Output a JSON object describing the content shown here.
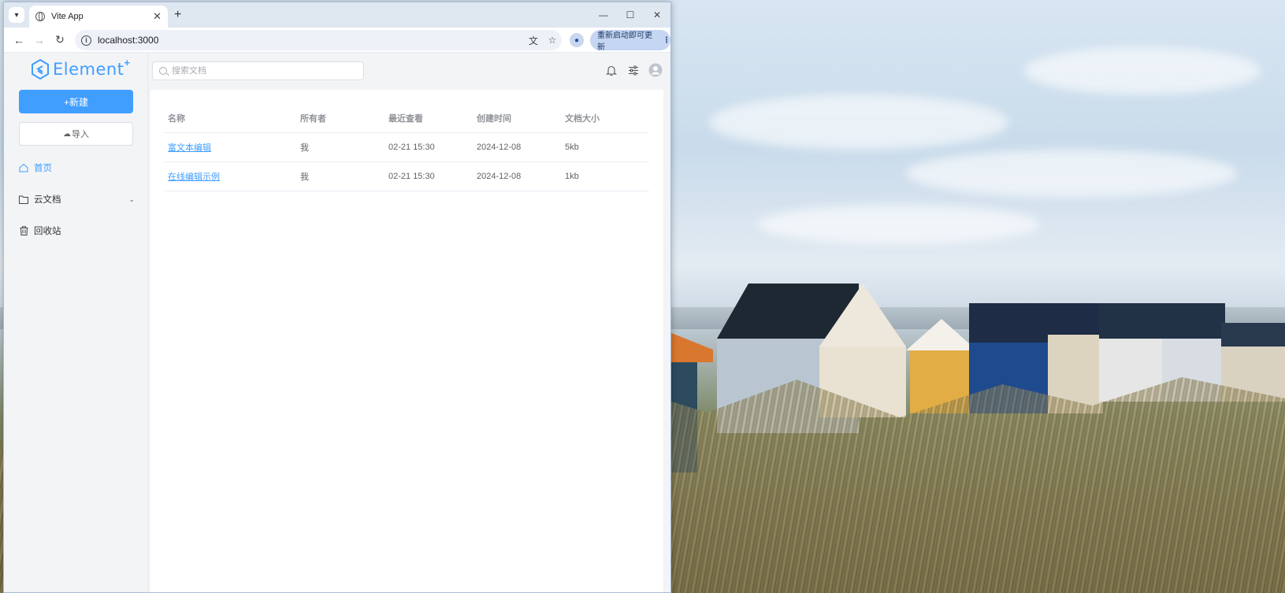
{
  "browser": {
    "tab_title": "Vite App",
    "url": "localhost:3000",
    "update_label": "重新启动即可更新"
  },
  "app": {
    "logo_text": "Element",
    "logo_plus": "+",
    "new_button": "+新建",
    "import_button": "导入",
    "search_placeholder": "搜索文档",
    "menu": [
      {
        "label": "首页",
        "icon": "home-icon",
        "active": true
      },
      {
        "label": "云文档",
        "icon": "folder-icon",
        "expandable": true
      },
      {
        "label": "回收站",
        "icon": "trash-icon"
      }
    ],
    "table": {
      "headers": [
        "名称",
        "所有者",
        "最近查看",
        "创建时间",
        "文档大小"
      ],
      "rows": [
        {
          "name": "富文本编辑",
          "owner": "我",
          "last_viewed": "02-21 15:30",
          "created": "2024-12-08",
          "size": "5kb"
        },
        {
          "name": "在线编辑示例",
          "owner": "我",
          "last_viewed": "02-21 15:30",
          "created": "2024-12-08",
          "size": "1kb"
        }
      ]
    }
  },
  "colors": {
    "accent": "#409eff",
    "sidebar_bg": "#f3f4f6",
    "header_text": "#909399"
  }
}
